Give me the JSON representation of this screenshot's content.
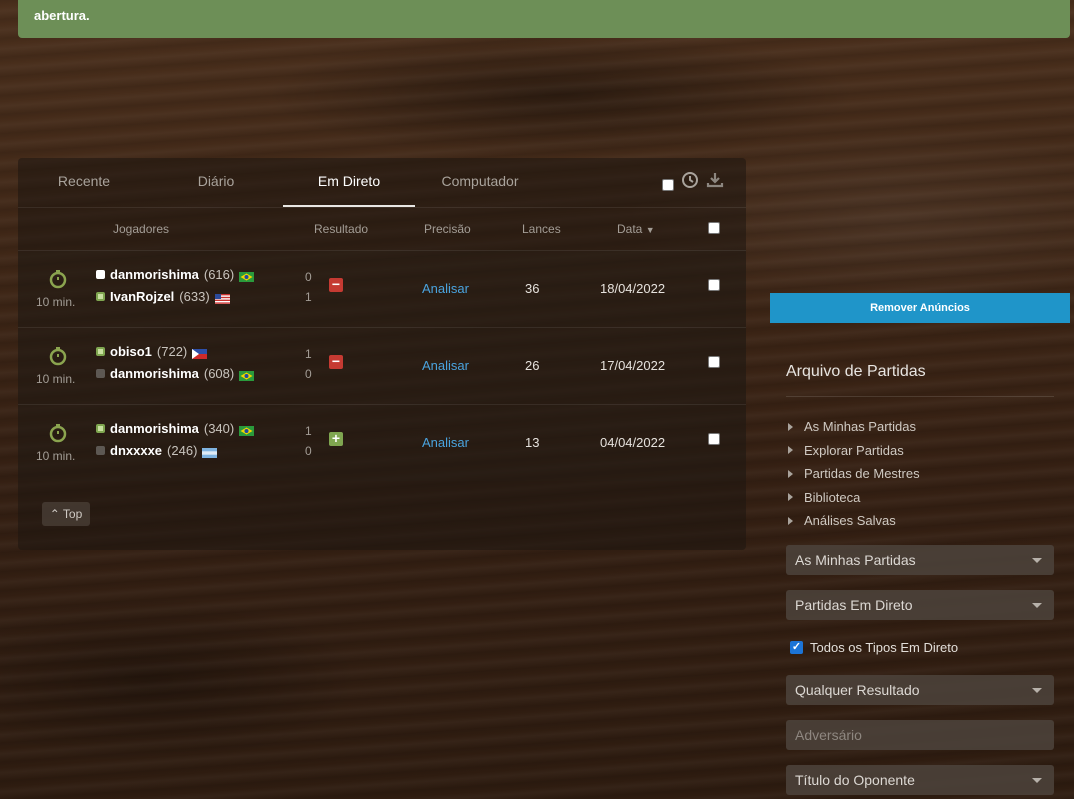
{
  "notice": {
    "text": "abertura."
  },
  "tabs": [
    {
      "label": "Recente"
    },
    {
      "label": "Diário"
    },
    {
      "label": "Em Direto"
    },
    {
      "label": "Computador"
    }
  ],
  "columns": {
    "players": "Jogadores",
    "result": "Resultado",
    "accuracy": "Precisão",
    "moves": "Lances",
    "date": "Data"
  },
  "games": [
    {
      "time": "10 min.",
      "white": {
        "name": "danmorishima",
        "rating": "(616)",
        "flag": "brazil"
      },
      "black": {
        "name": "IvanRojzel",
        "rating": "(633)",
        "flag": "usa"
      },
      "score_top": "0",
      "score_bottom": "1",
      "result": "loss",
      "result_symbol": "−",
      "analyze": "Analisar",
      "moves": "36",
      "date": "18/04/2022"
    },
    {
      "time": "10 min.",
      "white": {
        "name": "obiso1",
        "rating": "(722)",
        "flag": "philippines"
      },
      "black": {
        "name": "danmorishima",
        "rating": "(608)",
        "flag": "brazil"
      },
      "score_top": "1",
      "score_bottom": "0",
      "result": "loss",
      "result_symbol": "−",
      "analyze": "Analisar",
      "moves": "26",
      "date": "17/04/2022"
    },
    {
      "time": "10 min.",
      "white": {
        "name": "danmorishima",
        "rating": "(340)",
        "flag": "brazil"
      },
      "black": {
        "name": "dnxxxxe",
        "rating": "(246)",
        "flag": "argentina"
      },
      "score_top": "1",
      "score_bottom": "0",
      "result": "win",
      "result_symbol": "+",
      "analyze": "Analisar",
      "moves": "13",
      "date": "04/04/2022"
    }
  ],
  "top_button": "Top",
  "sidebar": {
    "remove_ads": "Remover Anúncios",
    "title": "Arquivo de Partidas",
    "links": [
      "As Minhas Partidas",
      "Explorar Partidas",
      "Partidas de Mestres",
      "Biblioteca",
      "Análises Salvas"
    ],
    "select_my_games": "As Minhas Partidas",
    "select_live": "Partidas Em Direto",
    "checkbox_all_live": "Todos os Tipos Em Direto",
    "select_result": "Qualquer Resultado",
    "opponent_placeholder": "Adversário",
    "select_title": "Título do Oponente"
  },
  "colors": {
    "accent_green": "#6d8f57",
    "link_blue": "#4aa3de",
    "loss_red": "#c53a32",
    "win_green": "#7fa650",
    "ads_blue": "#1f95c9"
  }
}
